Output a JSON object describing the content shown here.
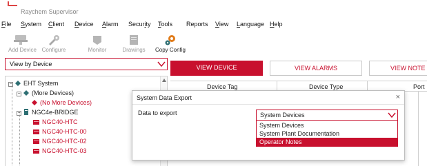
{
  "window": {
    "title": "Raychem Supervisor"
  },
  "menu": [
    {
      "label": "File",
      "u": "F",
      "rest": "ile"
    },
    {
      "label": "System",
      "u": "S",
      "rest": "ystem"
    },
    {
      "label": "Client",
      "u": "C",
      "rest": "lient"
    },
    {
      "label": "Device",
      "u": "D",
      "rest": "evice"
    },
    {
      "label": "Alarm",
      "u": "A",
      "rest": "larm"
    },
    {
      "label": "Security",
      "pre": "Secur",
      "u": "i",
      "rest": "ty"
    },
    {
      "label": "Tools",
      "u": "T",
      "rest": "ools"
    },
    {
      "label": "Reports",
      "pre": "Reports",
      "u": "",
      "rest": ""
    },
    {
      "label": "View",
      "u": "V",
      "rest": "iew"
    },
    {
      "label": "Language",
      "u": "L",
      "rest": "anguage"
    },
    {
      "label": "Help",
      "u": "H",
      "rest": "elp"
    }
  ],
  "toolbar": {
    "add_device": "Add Device",
    "configure": "Configure",
    "monitor": "Monitor",
    "drawings": "Drawings",
    "copy_config": "Copy Config"
  },
  "view_selector": {
    "value": "View by Device"
  },
  "tree": {
    "root": "EHT System",
    "more_devices": "(More Devices)",
    "no_more_devices": "(No More Devices)",
    "bridge": "NGC4e-BRIDGE",
    "devices": [
      "NGC40-HTC",
      "NGC40-HTC-00",
      "NGC40-HTC-02",
      "NGC40-HTC-03"
    ]
  },
  "tabs": {
    "view_device": "VIEW DEVICE",
    "view_alarms": "VIEW ALARMS",
    "view_notes": "VIEW NOTE"
  },
  "grid": {
    "columns": [
      "Device Tag",
      "Device Type",
      "Port"
    ]
  },
  "dialog": {
    "title": "System Data Export",
    "close": "×",
    "label": "Data to export",
    "selected": "System Devices",
    "options": [
      "System Devices",
      "System Plant Documentation",
      "Operator Notes"
    ],
    "highlighted_index": 2
  },
  "colors": {
    "accent": "#c8102e",
    "tree_icon": "#2e6f73"
  }
}
